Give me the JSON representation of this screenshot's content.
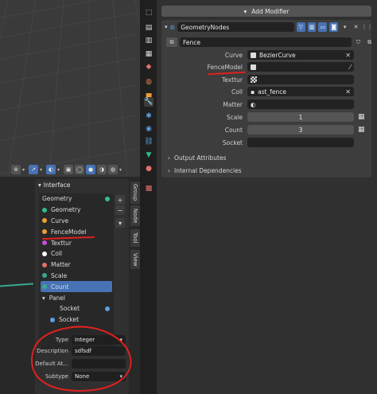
{
  "properties": {
    "add_modifier": "Add Modifier",
    "modifier_name": "GeometryNodes",
    "node_group": "Fence",
    "inputs": [
      {
        "label": "Curve",
        "value": "BezierCurve",
        "kind": "object"
      },
      {
        "label": "FenceModel",
        "value": "",
        "kind": "object-pick"
      },
      {
        "label": "Texttur",
        "value": "",
        "kind": "texture"
      },
      {
        "label": "Coll",
        "value": "ast_fence",
        "kind": "collection"
      },
      {
        "label": "Matter",
        "value": "",
        "kind": "material"
      },
      {
        "label": "Scale",
        "value": "1",
        "kind": "number"
      },
      {
        "label": "Count",
        "value": "3",
        "kind": "number"
      },
      {
        "label": "Socket",
        "value": "",
        "kind": "empty"
      }
    ],
    "sections": [
      "Output Attributes",
      "Internal Dependencies"
    ]
  },
  "node_sidebar": {
    "panel_title": "Interface",
    "items": [
      {
        "label": "Geometry",
        "color": "#2fbf8a",
        "side": "right"
      },
      {
        "label": "Geometry",
        "color": "#2fbf8a",
        "side": "left"
      },
      {
        "label": "Curve",
        "color": "#f0a030",
        "side": "left"
      },
      {
        "label": "FenceModel",
        "color": "#f0a030",
        "side": "left"
      },
      {
        "label": "Texttur",
        "color": "#c84fd0",
        "side": "left"
      },
      {
        "label": "Coll",
        "color": "#ffffff",
        "side": "left"
      },
      {
        "label": "Matter",
        "color": "#e07070",
        "side": "left"
      },
      {
        "label": "Scale",
        "color": "#3aa891",
        "side": "left"
      },
      {
        "label": "Count",
        "color": "#3aa891",
        "side": "left",
        "selected": true
      },
      {
        "label": "Panel",
        "color": "",
        "side": "panel"
      },
      {
        "label": "Socket",
        "color": "#5aa0e0",
        "side": "right"
      },
      {
        "label": "Socket",
        "color": "#5aa0e0",
        "side": "left"
      }
    ],
    "fields": [
      {
        "label": "Type",
        "value": "Integer",
        "dropdown": true
      },
      {
        "label": "Description",
        "value": "sdfsdf",
        "dropdown": false
      },
      {
        "label": "Default At...",
        "value": "",
        "dropdown": false
      },
      {
        "label": "Subtype",
        "value": "None",
        "dropdown": true
      }
    ],
    "tabs": [
      "Group",
      "Node",
      "Tool",
      "View"
    ]
  },
  "colors": {
    "accent": "#4772b3",
    "annotation": "#e02020"
  }
}
